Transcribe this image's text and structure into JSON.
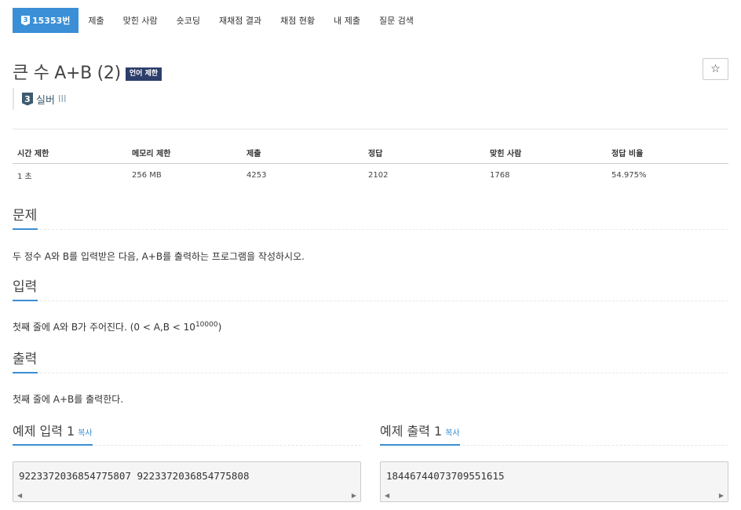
{
  "nav": {
    "problem_tab": {
      "tier_number": "3",
      "label": "15353번"
    },
    "items": [
      "제출",
      "맞힌 사람",
      "숏코딩",
      "재채점 결과",
      "채점 현황",
      "내 제출",
      "질문 검색"
    ]
  },
  "problem": {
    "title": "큰 수 A+B (2)",
    "lang_badge": "언어 제한",
    "star_icon": "☆",
    "tier_number": "3",
    "tier_name": "실버",
    "tier_level": "III"
  },
  "stats": {
    "headers": [
      "시간 제한",
      "메모리 제한",
      "제출",
      "정답",
      "맞힌 사람",
      "정답 비율"
    ],
    "values": [
      "1 초",
      "256 MB",
      "4253",
      "2102",
      "1768",
      "54.975%"
    ]
  },
  "sections": {
    "problem": {
      "title": "문제",
      "text": "두 정수 A와 B를 입력받은 다음, A+B를 출력하는 프로그램을 작성하시오."
    },
    "input": {
      "title": "입력",
      "text_prefix": "첫째 줄에 A와 B가 주어진다. (0 < A,B < 10",
      "text_sup": "10000",
      "text_suffix": ")"
    },
    "output": {
      "title": "출력",
      "text": "첫째 줄에 A+B를 출력한다."
    }
  },
  "samples": {
    "copy_label": "복사",
    "input": {
      "title": "예제 입력 1",
      "value": "9223372036854775807 9223372036854775808"
    },
    "output": {
      "title": "예제 출력 1",
      "value": "18446744073709551615"
    }
  },
  "colors": {
    "accent": "#3a8fd6",
    "lang_badge": "#2d3e6b",
    "tier": "#3e5a6e"
  }
}
